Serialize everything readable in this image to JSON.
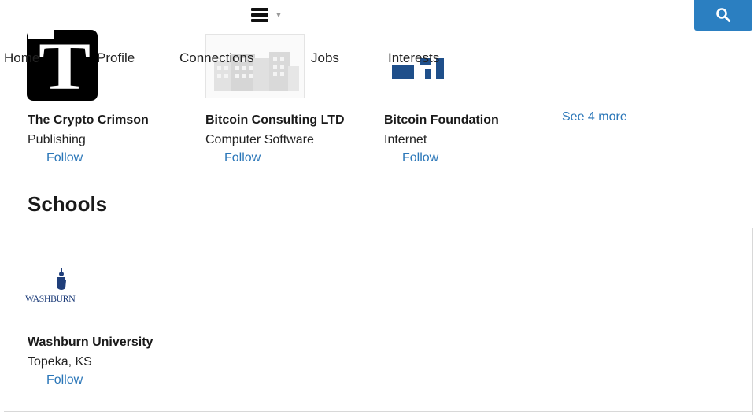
{
  "header": {
    "menu_icon": "hamburger-icon",
    "search_icon": "search-icon",
    "accent_color": "#2b7fc1"
  },
  "nav": {
    "items": [
      "Home",
      "Profile",
      "Connections",
      "Jobs",
      "Interests"
    ]
  },
  "companies": [
    {
      "logo_text": "T",
      "name": "The Crypto Crimson",
      "industry": "Publishing",
      "follow": "Follow"
    },
    {
      "name": "Bitcoin Consulting LTD",
      "industry": "Computer Software",
      "follow": "Follow"
    },
    {
      "name": "Bitcoin Foundation",
      "industry": "Internet",
      "follow": "Follow"
    }
  ],
  "see_more": "See 4 more",
  "schools": {
    "title": "Schools",
    "items": [
      {
        "logo_text": "WASHBURN",
        "name": "Washburn University",
        "location": "Topeka, KS",
        "follow": "Follow"
      }
    ]
  },
  "link_color": "#2a76b8"
}
